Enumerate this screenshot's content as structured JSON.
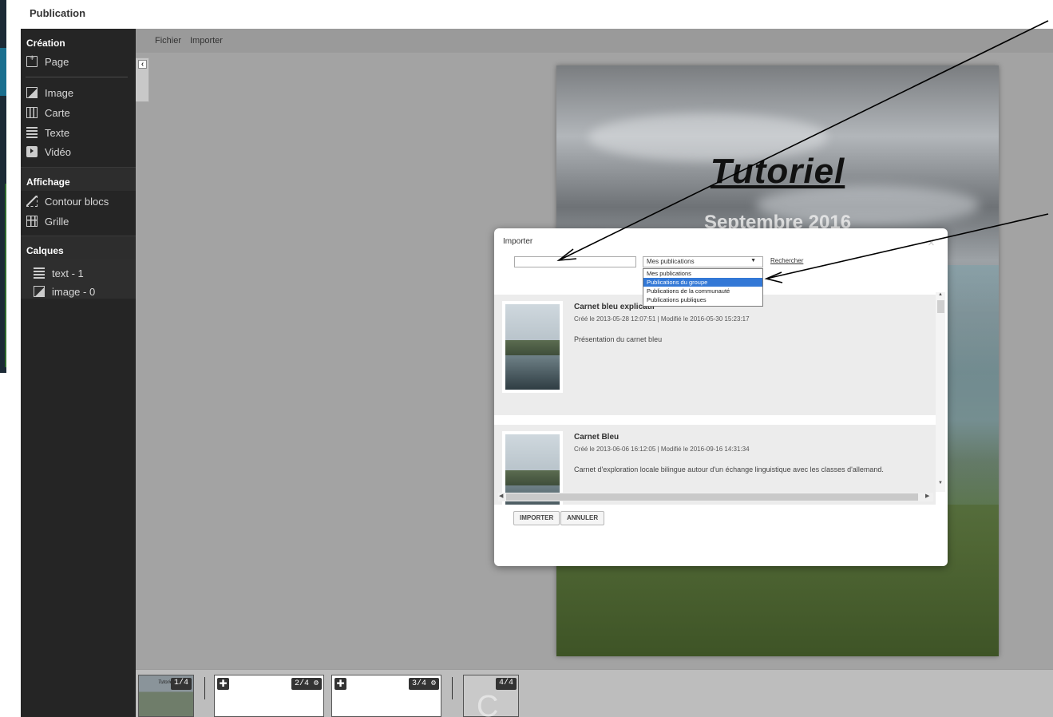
{
  "app": {
    "title": "Publication"
  },
  "sidebar": {
    "creation": {
      "heading": "Création",
      "items": [
        {
          "label": "Page",
          "icon": "page-icon"
        },
        {
          "label": "Image",
          "icon": "image-icon"
        },
        {
          "label": "Carte",
          "icon": "map-icon"
        },
        {
          "label": "Texte",
          "icon": "text-icon"
        },
        {
          "label": "Vidéo",
          "icon": "video-icon"
        }
      ]
    },
    "affichage": {
      "heading": "Affichage",
      "items": [
        {
          "label": "Contour blocs",
          "icon": "contour-icon"
        },
        {
          "label": "Grille",
          "icon": "grid-icon"
        }
      ]
    },
    "calques": {
      "heading": "Calques",
      "items": [
        {
          "label": "text - 1",
          "icon": "text-icon"
        },
        {
          "label": "image - 0",
          "icon": "image-icon"
        }
      ]
    }
  },
  "menu": {
    "file": "Fichier",
    "import": "Importer"
  },
  "page_preview": {
    "title": "Tutoriel",
    "subtitle": "Septembre 2016"
  },
  "thumbnails": [
    {
      "label": "1/4",
      "caption": "Tutoriel"
    },
    {
      "label": "2/4"
    },
    {
      "label": "3/4"
    },
    {
      "label": "4/4"
    }
  ],
  "import_dialog": {
    "title": "Importer",
    "close": "×",
    "search_value": "",
    "select_value": "Mes publications",
    "search_link": "Rechercher",
    "options": [
      "Mes publications",
      "Publications du groupe",
      "Publications de la communauté",
      "Publications publiques"
    ],
    "selected_option_index": 1,
    "results": [
      {
        "name": "Carnet bleu explicatif",
        "meta": "Créé le 2013-05-28 12:07:51 | Modifié le 2016-05-30 15:23:17",
        "description": "Présentation du carnet bleu"
      },
      {
        "name": "Carnet Bleu",
        "meta": "Créé le 2013-06-06 16:12:05 | Modifié le 2016-09-16 14:31:34",
        "description": "Carnet d'exploration locale bilingue autour d'un échange linguistique avec les classes d'allemand."
      }
    ],
    "import_button": "IMPORTER",
    "cancel_button": "ANNULER"
  }
}
